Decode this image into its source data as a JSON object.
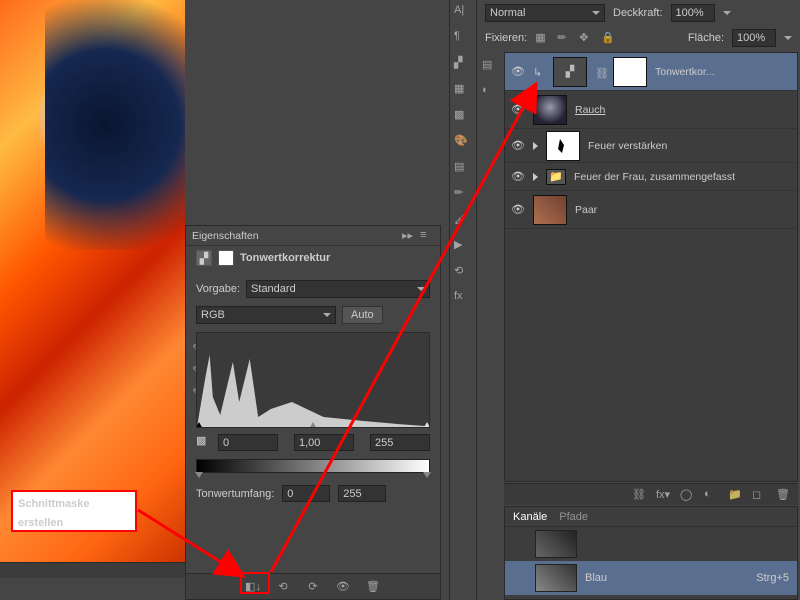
{
  "annotation": {
    "label": "Schnittmaske erstellen"
  },
  "properties_panel": {
    "title": "Eigenschaften",
    "adjustment_name": "Tonwertkorrektur",
    "preset_label": "Vorgabe:",
    "preset_value": "Standard",
    "channel": "RGB",
    "auto_btn": "Auto",
    "shadows": "0",
    "midtones": "1,00",
    "highlights": "255",
    "range_label": "Tonwertumfang:",
    "range_min": "0",
    "range_max": "255"
  },
  "layers_panel": {
    "blend_mode": "Normal",
    "opacity_label": "Deckkraft:",
    "opacity_value": "100%",
    "lock_label": "Fixieren:",
    "fill_label": "Fläche:",
    "fill_value": "100%",
    "layers": [
      {
        "name": "Tonwertkor..."
      },
      {
        "name": "Rauch"
      },
      {
        "name": "Feuer verstärken"
      },
      {
        "name": "Feuer der Frau, zusammengefasst"
      },
      {
        "name": "Paar"
      }
    ]
  },
  "channels_panel": {
    "tab1": "Kanäle",
    "tab2": "Pfade",
    "channel_name": "Blau",
    "shortcut": "Strg+5"
  }
}
